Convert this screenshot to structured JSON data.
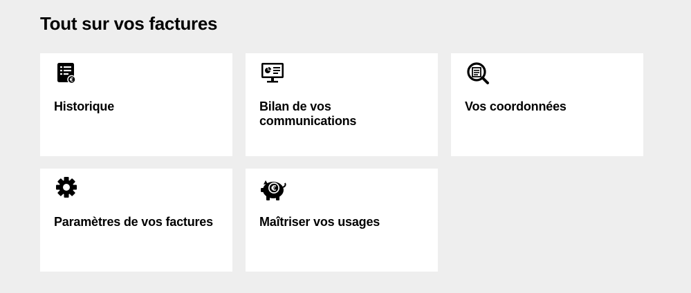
{
  "page": {
    "title": "Tout sur vos factures"
  },
  "cards": [
    {
      "label": "Historique",
      "icon": "invoice-history-icon"
    },
    {
      "label": "Bilan de vos communications",
      "icon": "monitor-report-icon"
    },
    {
      "label": "Vos coordonnées",
      "icon": "search-document-icon"
    },
    {
      "label": "Paramètres de vos factures",
      "icon": "gear-icon"
    },
    {
      "label": "Maîtriser vos usages",
      "icon": "piggy-bank-euro-icon"
    }
  ]
}
